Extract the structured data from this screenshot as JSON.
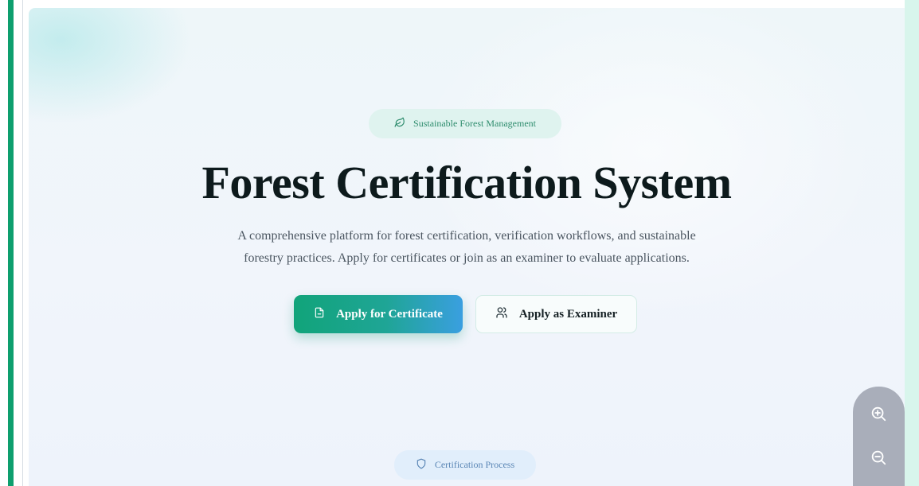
{
  "hero": {
    "badge": {
      "icon": "leaf-icon",
      "label": "Sustainable Forest Management"
    },
    "title": "Forest Certification System",
    "description_line1": "A comprehensive platform for forest certification, verification workflows, and sustainable",
    "description_line2": "forestry practices. Apply for certificates or join as an examiner to evaluate applications.",
    "primary_button": {
      "icon": "document-icon",
      "label": "Apply for Certificate"
    },
    "secondary_button": {
      "icon": "users-icon",
      "label": "Apply as Examiner"
    }
  },
  "process_section": {
    "icon": "shield-icon",
    "label": "Certification Process"
  },
  "zoom_controls": {
    "zoom_in_icon": "zoom-in-icon",
    "zoom_out_icon": "zoom-out-icon"
  },
  "colors": {
    "accent_green": "#0e9f6e",
    "button_gradient_start": "#11a47a",
    "button_gradient_end": "#3a9fe0",
    "title_text": "#0d1a1c",
    "badge_text": "#2f8d6e"
  }
}
